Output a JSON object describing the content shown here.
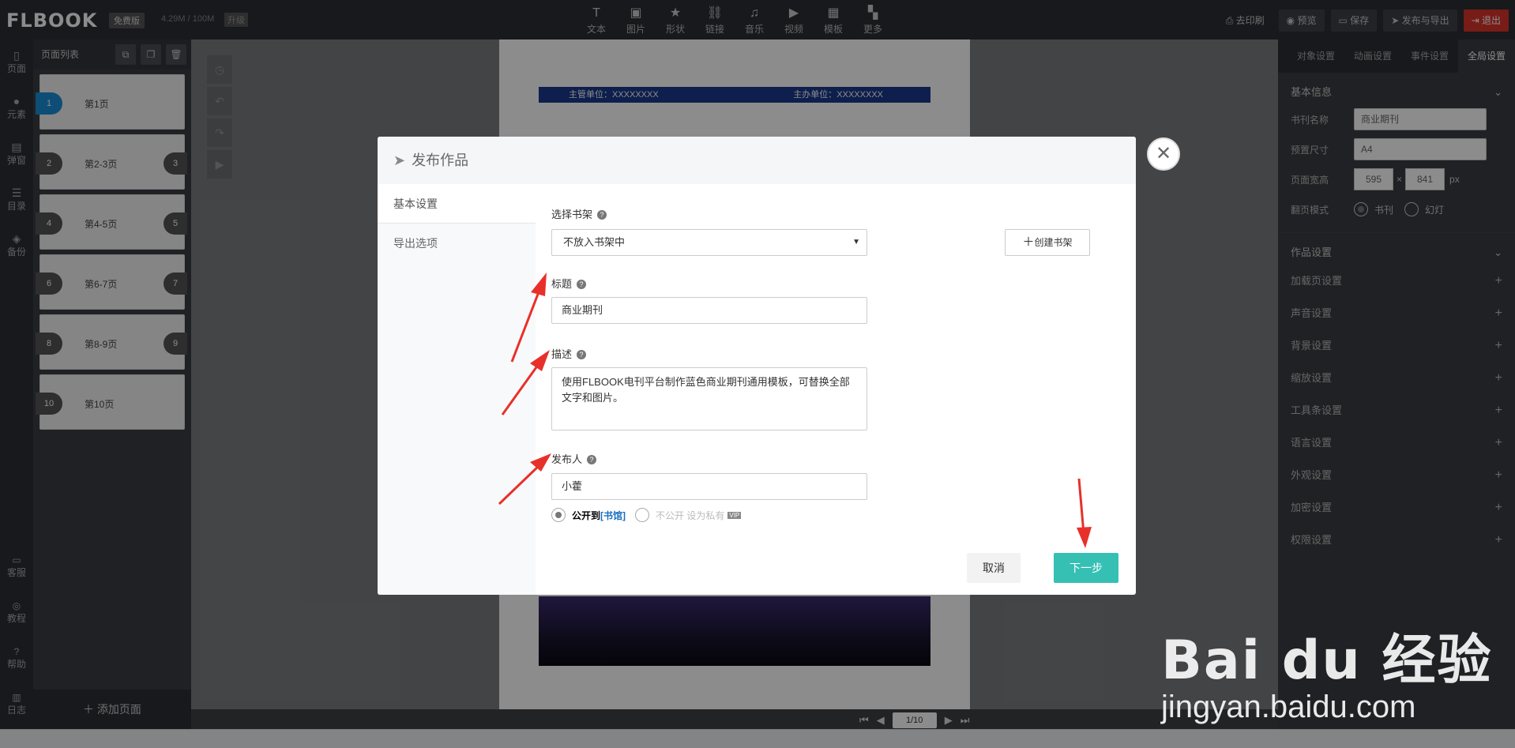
{
  "topbar": {
    "logo": "FLBOOK",
    "version_badge": "免费版",
    "quota": "4.29M / 100M",
    "upgrade": "升级",
    "tools": [
      {
        "icon": "text-icon",
        "glyph": "T",
        "label": "文本"
      },
      {
        "icon": "image-icon",
        "glyph": "▣",
        "label": "图片"
      },
      {
        "icon": "shape-icon",
        "glyph": "★",
        "label": "形状"
      },
      {
        "icon": "link-icon",
        "glyph": "⛓",
        "label": "链接"
      },
      {
        "icon": "music-icon",
        "glyph": "♫",
        "label": "音乐"
      },
      {
        "icon": "video-icon",
        "glyph": "▶",
        "label": "视频"
      },
      {
        "icon": "template-icon",
        "glyph": "▦",
        "label": "模板"
      },
      {
        "icon": "more-icon",
        "glyph": "▚",
        "label": "更多"
      }
    ],
    "print": "去印刷",
    "preview": "预览",
    "save": "保存",
    "publish": "发布与导出",
    "exit": "退出"
  },
  "leftnav": {
    "items": [
      {
        "icon": "page-icon",
        "label": "页面"
      },
      {
        "icon": "element-icon",
        "label": "元素"
      },
      {
        "icon": "popup-icon",
        "label": "弹窗"
      },
      {
        "icon": "toc-icon",
        "label": "目录"
      },
      {
        "icon": "backup-icon",
        "label": "备份"
      }
    ],
    "bottom": [
      {
        "icon": "service-icon",
        "label": "客服"
      },
      {
        "icon": "tutorial-icon",
        "label": "教程"
      },
      {
        "icon": "help-icon",
        "label": "帮助"
      },
      {
        "icon": "log-icon",
        "label": "日志"
      }
    ]
  },
  "pages": {
    "title": "页面列表",
    "items": [
      {
        "num": "1",
        "num2": "",
        "label": "第1页"
      },
      {
        "num": "2",
        "num2": "3",
        "label": "第2-3页"
      },
      {
        "num": "4",
        "num2": "5",
        "label": "第4-5页"
      },
      {
        "num": "6",
        "num2": "7",
        "label": "第6-7页"
      },
      {
        "num": "8",
        "num2": "9",
        "label": "第8-9页"
      },
      {
        "num": "10",
        "num2": "",
        "label": "第10页"
      }
    ],
    "add": "添加页面"
  },
  "paper": {
    "left_unit": "主管单位：XXXXXXXX",
    "right_unit": "主办单位：XXXXXXXX"
  },
  "pager": {
    "value": "1/10"
  },
  "rightpanel": {
    "tabs": [
      "对象设置",
      "动画设置",
      "事件设置",
      "全局设置"
    ],
    "basic": {
      "title": "基本信息",
      "name_label": "书刊名称",
      "name_value": "商业期刊",
      "size_label": "预置尺寸",
      "size_value": "A4",
      "dims_label": "页面宽高",
      "width": "595",
      "height": "841",
      "unit": "px",
      "mode_label": "翻页模式",
      "mode_book": "书刊",
      "mode_slide": "幻灯"
    },
    "work_title": "作品设置",
    "items": [
      "加载页设置",
      "声音设置",
      "背景设置",
      "缩放设置",
      "工具条设置",
      "语言设置",
      "外观设置",
      "加密设置",
      "权限设置"
    ]
  },
  "modal": {
    "title": "发布作品",
    "tabs": [
      "基本设置",
      "导出选项"
    ],
    "shelf_label": "选择书架",
    "shelf_value": "不放入书架中",
    "create_shelf": "创建书架",
    "title_label": "标题",
    "title_value": "商业期刊",
    "desc_label": "描述",
    "desc_value": "使用FLBOOK电刊平台制作蓝色商业期刊通用模板，可替换全部文字和图片。",
    "publisher_label": "发布人",
    "publisher_value": "小藿",
    "public_prefix": "公开到",
    "public_link": "[书馆]",
    "private_label": "不公开 设为私有",
    "vip": "VIP",
    "cancel": "取消",
    "next": "下一步"
  },
  "watermark": {
    "brand": "Bai du 经验",
    "url": "jingyan.baidu.com"
  },
  "colors": {
    "accent_teal": "#36c0b4",
    "exit_red": "#d9342b",
    "annotation_red": "#e8302a",
    "page_active": "#1a8fd8"
  }
}
